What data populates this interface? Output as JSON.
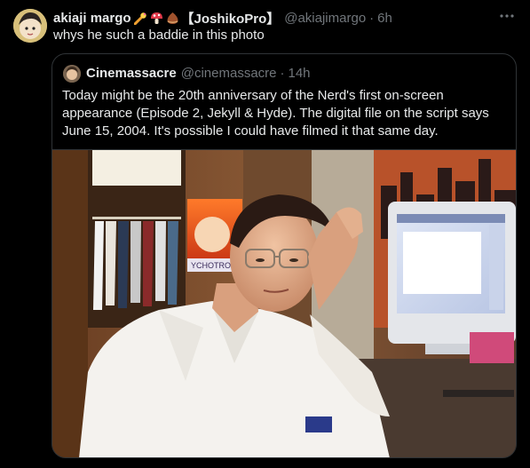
{
  "post": {
    "display_name": "akiaji margo",
    "name_suffix": "【JoshikoPro】",
    "emoji_icons": [
      "comet-icon",
      "mushroom-icon",
      "chestnut-icon"
    ],
    "handle": "@akiajimargo",
    "separator": "·",
    "time": "6h",
    "text": "whys he such a baddie in this photo",
    "more_icon": "more-horizontal-icon"
  },
  "quoted_post": {
    "display_name": "Cinemassacre",
    "handle": "@cinemassacre",
    "separator": "·",
    "time": "14h",
    "text": "Today might be the 20th anniversary of the Nerd's first on-screen appearance (Episode 2, Jekyll & Hyde). The digital file on the script says June 15, 2004. It's possible I could have filmed it that same day.",
    "photo_poster_text": "YCHOTROP"
  },
  "colors": {
    "background": "#000000",
    "primary_text": "#e7e9ea",
    "secondary_text": "#71767b",
    "border": "#2f3336"
  }
}
